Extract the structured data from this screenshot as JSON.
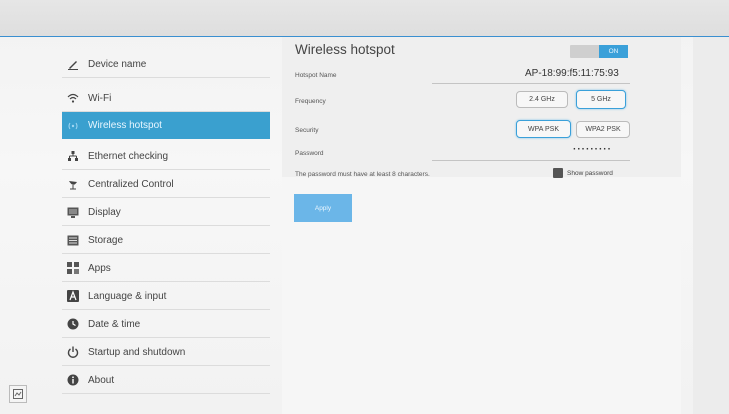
{
  "sidebar": {
    "items": [
      {
        "label": "Device name",
        "icon": "pencil-icon"
      },
      {
        "label": "Wi-Fi",
        "icon": "wifi-icon"
      },
      {
        "label": "Wireless hotspot",
        "icon": "hotspot-icon",
        "active": true
      },
      {
        "label": "Ethernet checking",
        "icon": "network-icon"
      },
      {
        "label": "Centralized Control",
        "icon": "satellite-icon"
      },
      {
        "label": "Display",
        "icon": "display-icon"
      },
      {
        "label": "Storage",
        "icon": "storage-icon"
      },
      {
        "label": "Apps",
        "icon": "apps-icon"
      },
      {
        "label": "Language & input",
        "icon": "language-icon"
      },
      {
        "label": "Date & time",
        "icon": "clock-icon"
      },
      {
        "label": "Startup and shutdown",
        "icon": "power-icon"
      },
      {
        "label": "About",
        "icon": "info-icon"
      }
    ]
  },
  "hotspot": {
    "title": "Wireless hotspot",
    "toggle_label": "ON",
    "name_label": "Hotspot Name",
    "name_value": "AP-18:99:f5:11:75:93",
    "frequency_label": "Frequency",
    "freq_options": [
      "2.4 GHz",
      "5 GHz"
    ],
    "freq_selected": "5 GHz",
    "security_label": "Security",
    "security_options": [
      "WPA PSK",
      "WPA2 PSK"
    ],
    "security_selected": "WPA PSK",
    "password_label": "Password",
    "password_value": "·········",
    "note": "The password must have at least 8 characters.",
    "show_password_label": "Show password",
    "apply_label": "Apply"
  },
  "colors": {
    "accent": "#3aa0cf",
    "toggle_on": "#3aa0d9",
    "apply": "#6bb6e8"
  }
}
